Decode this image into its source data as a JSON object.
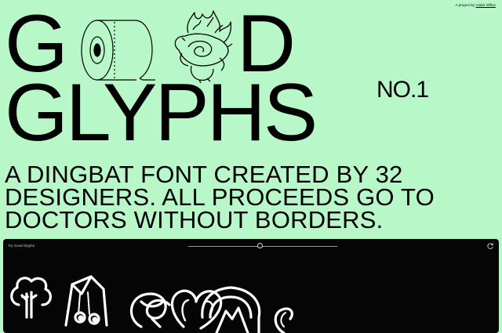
{
  "credit": {
    "prefix": "A project by",
    "link": "Violet Office"
  },
  "hero": {
    "title_part1": "G",
    "title_part2": "D",
    "title_line2": "GLYPHS",
    "edition": "NO.1"
  },
  "subtitle": {
    "line1": "A DINGBAT FONT CREATED BY 32",
    "line2": "DESIGNERS. ALL PROCEEDS GO TO",
    "line3": "DOCTORS WITHOUT BORDERS."
  },
  "tester": {
    "label": "Try Good Glyphs",
    "size_value": 0.48,
    "reset_icon": "refresh-icon"
  },
  "colors": {
    "background": "#b8f7c8",
    "panel": "#050505",
    "text": "#000000"
  }
}
